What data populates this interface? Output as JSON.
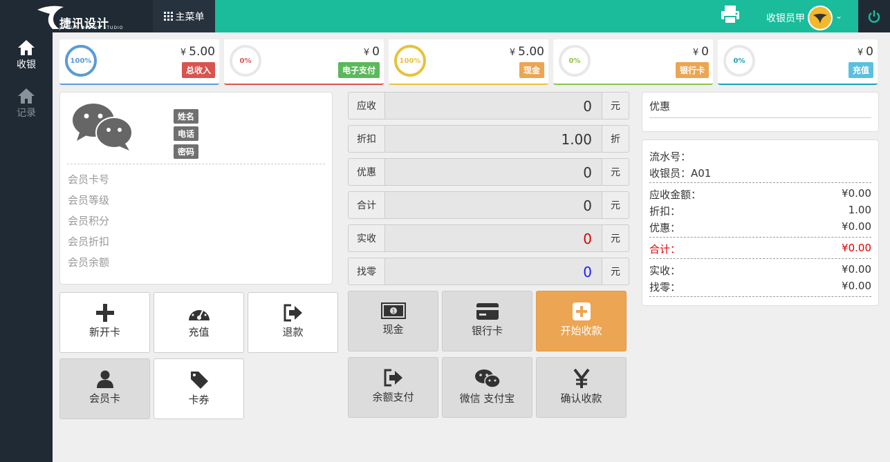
{
  "app": {
    "logo_text": "捷讯设计",
    "logo_sub": "JETSUM DESIGN STUDIO",
    "main_menu": "主菜单",
    "user": "收银员甲"
  },
  "sidebar": [
    {
      "label": "收银"
    },
    {
      "label": "记录"
    }
  ],
  "stats": [
    {
      "percent": "100%",
      "currency": "¥",
      "amount": "5.00",
      "label": "总收入",
      "color": "#5b9bd5",
      "badge_color": "#d9534f"
    },
    {
      "percent": "0%",
      "currency": "¥",
      "amount": "0",
      "label": "电子支付",
      "color": "#d9534f",
      "badge_color": "#5cb85c"
    },
    {
      "percent": "100%",
      "currency": "¥",
      "amount": "5.00",
      "label": "现金",
      "color": "#e8c23d",
      "badge_color": "#eca552"
    },
    {
      "percent": "0%",
      "currency": "¥",
      "amount": "0",
      "label": "银行卡",
      "color": "#8bc34a",
      "badge_color": "#eca552"
    },
    {
      "percent": "0%",
      "currency": "¥",
      "amount": "0",
      "label": "充值",
      "color": "#17a2b8",
      "badge_color": "#5bc0de"
    }
  ],
  "member": {
    "tags": [
      "姓名",
      "电话",
      "密码"
    ],
    "fields": [
      "会员卡号",
      "会员等级",
      "会员积分",
      "会员折扣",
      "会员余额"
    ]
  },
  "left_buttons": [
    "新开卡",
    "充值",
    "退款",
    "会员卡",
    "卡券"
  ],
  "form": [
    {
      "label": "应收",
      "value": "0",
      "unit": "元",
      "color": "#333"
    },
    {
      "label": "折扣",
      "value": "1.00",
      "unit": "折",
      "color": "#333"
    },
    {
      "label": "优惠",
      "value": "0",
      "unit": "元",
      "color": "#333"
    },
    {
      "label": "合计",
      "value": "0",
      "unit": "元",
      "color": "#333"
    },
    {
      "label": "实收",
      "value": "0",
      "unit": "元",
      "color": "#e00000"
    },
    {
      "label": "找零",
      "value": "0",
      "unit": "元",
      "color": "#1a1aff"
    }
  ],
  "pay_buttons": [
    "现金",
    "银行卡",
    "开始收款",
    "余额支付",
    "微信 支付宝",
    "确认收款"
  ],
  "discount_title": "优惠",
  "receipt": {
    "serial": "流水号：",
    "cashier": "收银员：A01",
    "rows": [
      {
        "label": "应收金额：",
        "value": "¥0.00"
      },
      {
        "label": "折扣：",
        "value": "1.00"
      },
      {
        "label": "优惠：",
        "value": "¥0.00"
      },
      {
        "label": "合计：",
        "value": "¥0.00"
      },
      {
        "label": "实收：",
        "value": "¥0.00"
      },
      {
        "label": "找零：",
        "value": "¥0.00"
      }
    ]
  }
}
